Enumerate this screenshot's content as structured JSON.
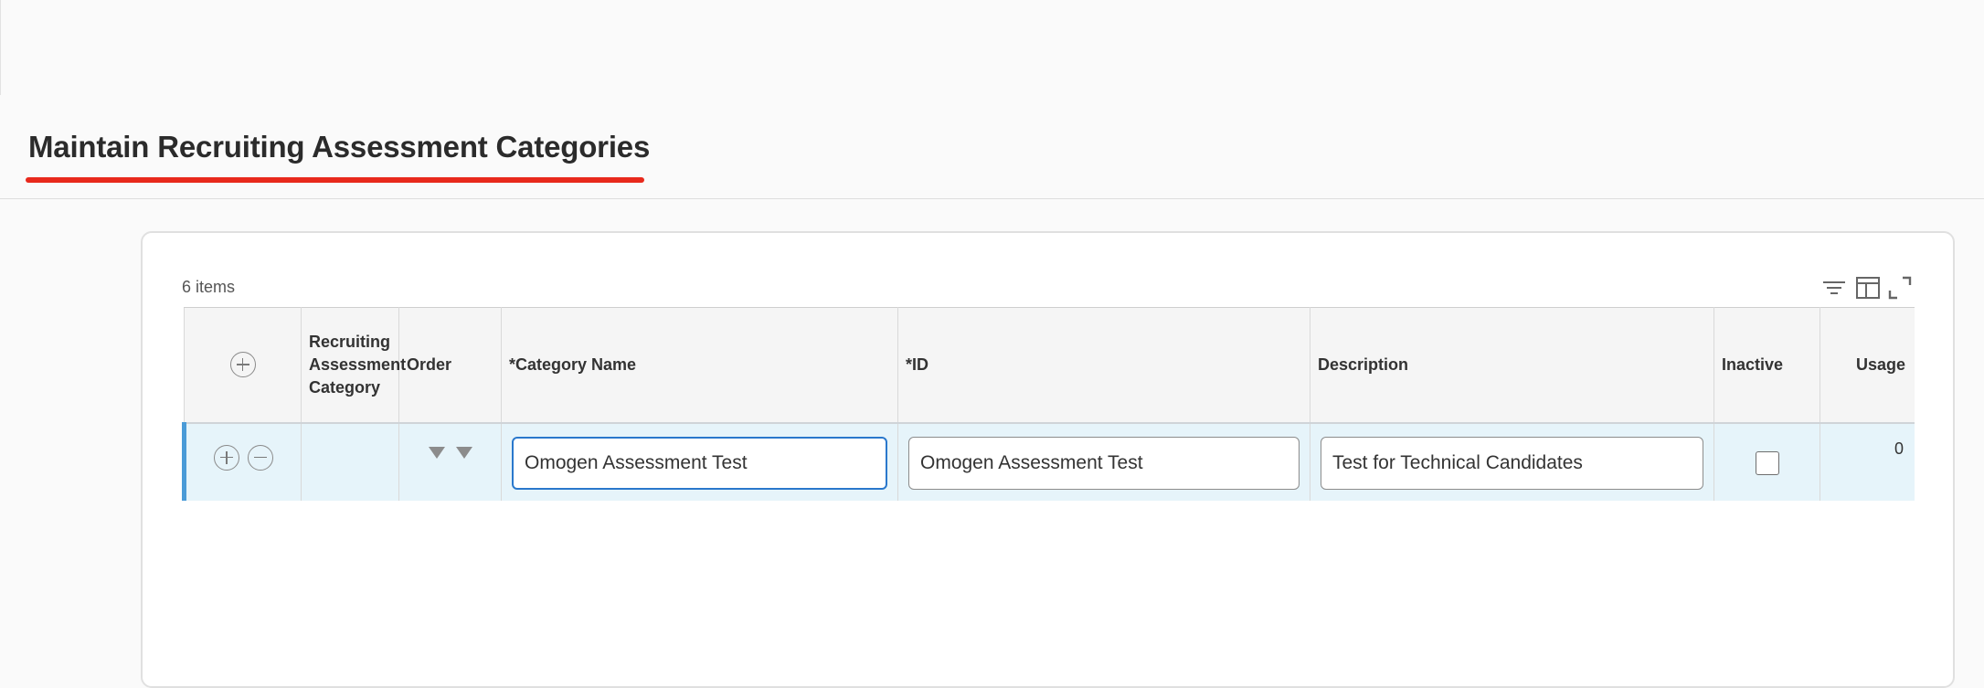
{
  "page": {
    "title": "Maintain Recruiting Assessment Categories"
  },
  "table": {
    "item_count": "6 items",
    "columns": {
      "category": "Recruiting Assessment Category",
      "order": "Order",
      "category_name": "*Category Name",
      "id": "*ID",
      "description": "Description",
      "inactive": "Inactive",
      "usage": "Usage"
    },
    "rows": [
      {
        "category": "",
        "category_name": "Omogen Assessment Test",
        "id": "Omogen Assessment Test",
        "description": "Test for Technical Candidates",
        "inactive": false,
        "usage": "0"
      }
    ]
  },
  "icons": {
    "toolbar": [
      "filter-icon",
      "column-layout-icon",
      "fullscreen-icon"
    ],
    "row": [
      "add-row-icon",
      "remove-row-icon",
      "move-down-icon",
      "move-down-icon"
    ],
    "header": [
      "add-row-icon"
    ]
  },
  "colors": {
    "title_underline": "#e8291c",
    "row_selected_bg": "#e6f4fa",
    "row_selected_marker": "#4a9bd7",
    "focused_input_border": "#2a78cc"
  }
}
